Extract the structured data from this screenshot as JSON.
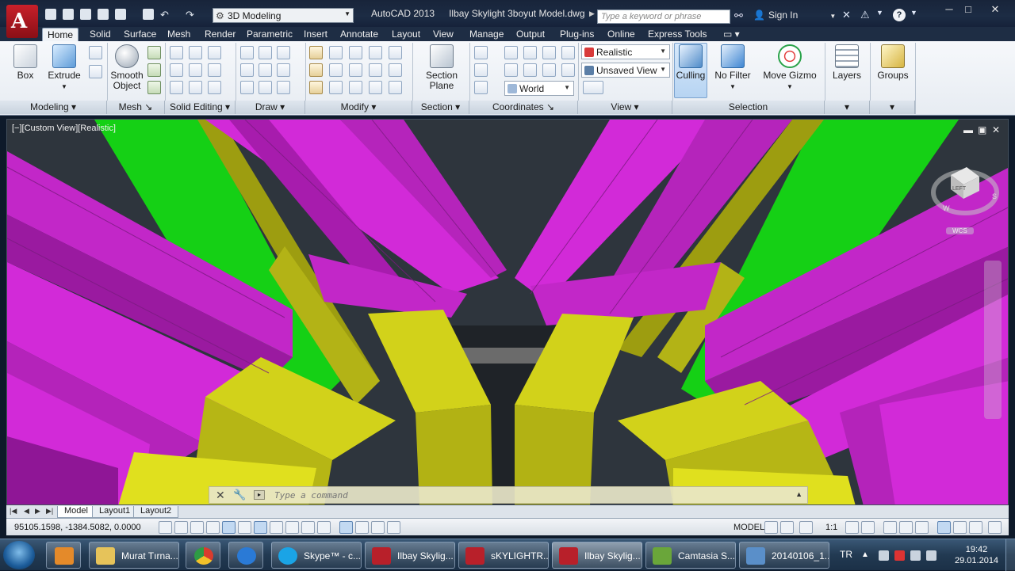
{
  "titlebar": {
    "app_name": "AutoCAD 2013",
    "file_name": "Ilbay Skylight 3boyut Model.dwg",
    "workspace": "3D Modeling",
    "search_placeholder": "Type a keyword or phrase",
    "sign_in": "Sign In",
    "help_label": "?"
  },
  "ribbon_tabs": [
    "Home",
    "Solid",
    "Surface",
    "Mesh",
    "Render",
    "Parametric",
    "Insert",
    "Annotate",
    "Layout",
    "View",
    "Manage",
    "Output",
    "Plug-ins",
    "Online",
    "Express Tools"
  ],
  "ribbon": {
    "box_label": "Box",
    "extrude_label": "Extrude",
    "smooth_object_label": "Smooth Object",
    "section_plane_label": "Section Plane",
    "visual_style": "Realistic",
    "saved_view": "Unsaved View",
    "ucs": "World",
    "culling_label": "Culling",
    "no_filter_label": "No Filter",
    "move_gizmo_label": "Move Gizmo",
    "layers_label": "Layers",
    "groups_label": "Groups",
    "panels": [
      "Modeling",
      "Mesh",
      "Solid Editing",
      "Draw",
      "Modify",
      "Section",
      "Coordinates",
      "View",
      "Selection"
    ]
  },
  "viewport": {
    "label": "[−][Custom View][Realistic]",
    "viewcube_face": "LEFT",
    "compass_w": "W",
    "compass_s": "S",
    "wcs": "WCS"
  },
  "command": {
    "placeholder": "Type a command"
  },
  "layout_tabs": [
    "Model",
    "Layout1",
    "Layout2"
  ],
  "statusbar": {
    "coordinates": "95105.1598, -1384.5082, 0.0000",
    "model": "MODEL",
    "scale": "1:1"
  },
  "taskbar": {
    "items": [
      "Murat Tırna...",
      "Skype™ - c...",
      "Ilbay Skylig...",
      "sKYLIGHTR...",
      "Ilbay Skylig...",
      "Camtasia S...",
      "20140106_1..."
    ],
    "lang": "TR",
    "time": "19:42",
    "date": "29.01.2014"
  },
  "colors": {
    "magenta": "#d22ad8",
    "yellow": "#d2d21a",
    "green": "#15d015",
    "olive": "#9d9d10",
    "background": "#2e353d"
  }
}
